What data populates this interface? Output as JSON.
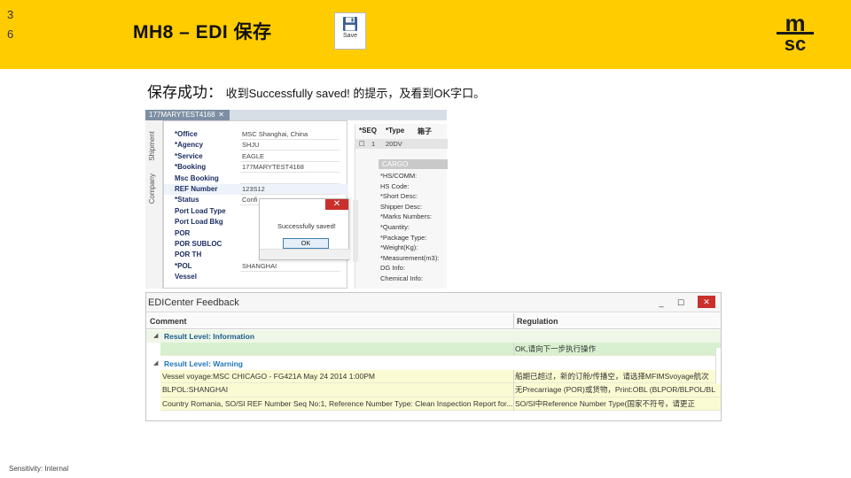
{
  "slide": {
    "page_number": "3 6",
    "title": "MH8 – EDI 保存",
    "caption_prefix": "保存成功：",
    "caption_text": "收到Successfully saved! 的提示，及看到OK字口。",
    "footer": "Sensitivity: Internal",
    "colors": {
      "banner": "#ffcc00",
      "logo": "#1a1a1a"
    }
  },
  "toolbar": {
    "save_label": "Save",
    "save_icon": "floppy-disk-icon"
  },
  "shipment": {
    "document_tab": "177MARYTEST4168",
    "side_tabs": [
      "Shipment",
      "Company"
    ],
    "fields": [
      {
        "label": "*Office",
        "value": "MSC Shanghai, China"
      },
      {
        "label": "*Agency",
        "value": "SHJU"
      },
      {
        "label": "*Service",
        "value": "EAGLE"
      },
      {
        "label": "*Booking",
        "value": "177MARYTEST4168"
      },
      {
        "label": "Msc Booking",
        "value": ""
      },
      {
        "label": "REF Number",
        "value": "123S12"
      },
      {
        "label": "*Status",
        "value": "Confi"
      },
      {
        "label": "Port Load Type",
        "value": ""
      },
      {
        "label": "Port Load Bkg",
        "value": ""
      },
      {
        "label": "POR",
        "value": ""
      },
      {
        "label": "POR SUBLOC",
        "value": ""
      },
      {
        "label": "POR TH",
        "value": ""
      },
      {
        "label": "*POL",
        "value": "SHANGHAI"
      },
      {
        "label": "Vessel",
        "value": ""
      }
    ]
  },
  "cargo": {
    "headers": [
      "*SEQ",
      "*Type",
      "箱子"
    ],
    "row": [
      "1",
      "20DV",
      ""
    ],
    "section": "CARGO",
    "items": [
      "*HS/COMM:",
      "HS Code:",
      "*Short Desc:",
      "Shipper Desc:",
      "*Marks Numbers:",
      "*Quantity:",
      "*Package Type:",
      "*Weight(Kg):",
      "*Measurement(m3):",
      "DG Info:",
      "Chemical Info:"
    ]
  },
  "dialog": {
    "message": "Successfully saved!",
    "ok_label": "OK",
    "close_label": "✕"
  },
  "feedback": {
    "title": "EDICenter Feedback",
    "columns": [
      "Comment",
      "Regulation"
    ],
    "info_group": "Result Level: Information",
    "info_row": {
      "comment": "",
      "regulation": "OK,请向下一步执行操作"
    },
    "warning_group": "Result Level: Warning",
    "warning_rows": [
      {
        "comment": "Vessel voyage:MSC CHICAGO - FG421A May 24 2014 1:00PM",
        "regulation": "船期已超过，新的订舱/传播空，请选择MFIMSvoyage航次"
      },
      {
        "comment": "BLPOL:SHANGHAI",
        "regulation": "无Precarriage (POR)或货物，Print:OBL (BLPOR/BLPOL/BL"
      },
      {
        "comment": "Country Romania, SO/SI REF Number Seq No:1, Reference Number Type: Clean Inspection Report for...",
        "regulation": "SO/SI中Reference Number Type(国家不符号，请更正"
      }
    ]
  }
}
